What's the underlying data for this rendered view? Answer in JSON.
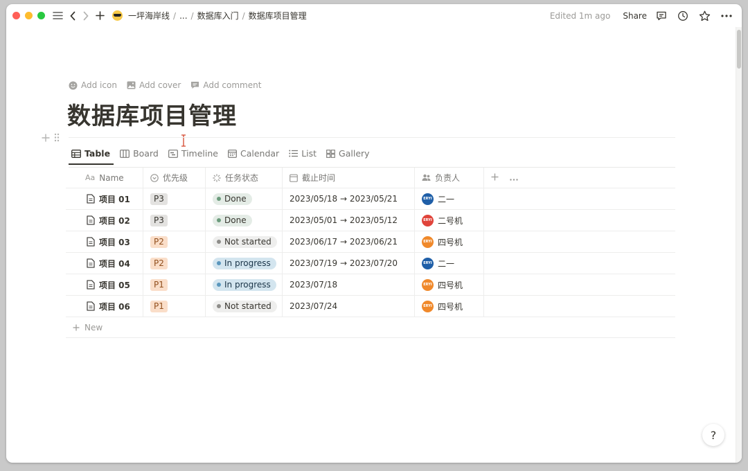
{
  "window": {
    "traffic_colors": [
      "#ff5f57",
      "#febc2e",
      "#28c840"
    ]
  },
  "breadcrumbs": {
    "workspace": "一坪海岸线",
    "ellipsis": "...",
    "parent": "数据库入门",
    "current": "数据库项目管理"
  },
  "topbar": {
    "edited": "Edited 1m ago",
    "share": "Share"
  },
  "page_actions": {
    "add_icon": "Add icon",
    "add_cover": "Add cover",
    "add_comment": "Add comment"
  },
  "page": {
    "title": "数据库项目管理"
  },
  "views": {
    "table": "Table",
    "board": "Board",
    "timeline": "Timeline",
    "calendar": "Calendar",
    "list": "List",
    "gallery": "Gallery"
  },
  "table": {
    "headers": {
      "name_prefix": "Aa",
      "name": "Name",
      "priority": "优先级",
      "status": "任务状态",
      "deadline": "截止时间",
      "owner": "负责人"
    },
    "rows": [
      {
        "name": "项目 01",
        "priority": "P3",
        "status": "Done",
        "deadline": "2023/05/18 → 2023/05/21",
        "owner": "二一",
        "avatar": "ERYI",
        "avatar_color": "#1f5fa8"
      },
      {
        "name": "项目 02",
        "priority": "P3",
        "status": "Done",
        "deadline": "2023/05/01 → 2023/05/12",
        "owner": "二号机",
        "avatar": "ERYI",
        "avatar_color": "#e0443b"
      },
      {
        "name": "项目 03",
        "priority": "P2",
        "status": "Not started",
        "deadline": "2023/06/17 → 2023/06/21",
        "owner": "四号机",
        "avatar": "ERYI",
        "avatar_color": "#f0892b"
      },
      {
        "name": "项目 04",
        "priority": "P2",
        "status": "In progress",
        "deadline": "2023/07/19 → 2023/07/20",
        "owner": "二一",
        "avatar": "ERYI",
        "avatar_color": "#1f5fa8"
      },
      {
        "name": "项目 05",
        "priority": "P1",
        "status": "In progress",
        "deadline": "2023/07/18",
        "owner": "四号机",
        "avatar": "ERYI",
        "avatar_color": "#f0892b"
      },
      {
        "name": "项目 06",
        "priority": "P1",
        "status": "Not started",
        "deadline": "2023/07/24",
        "owner": "四号机",
        "avatar": "ERYI",
        "avatar_color": "#f0892b"
      }
    ],
    "new_label": "New"
  },
  "help": "?",
  "colors": {
    "priority": {
      "P3": {
        "bg": "#e3e2e0",
        "fg": "#37352f"
      },
      "P2": {
        "bg": "#fadec9",
        "fg": "#914f1d"
      },
      "P1": {
        "bg": "#fadec9",
        "fg": "#914f1d"
      }
    },
    "status": {
      "Done": {
        "bg": "#e4ece6",
        "fg": "#37352f",
        "dot": "#6c9b7d"
      },
      "Not started": {
        "bg": "#eeeeed",
        "fg": "#37352f",
        "dot": "#8e8d8a"
      },
      "In progress": {
        "bg": "#d3e5ef",
        "fg": "#183347",
        "dot": "#5b97bd"
      }
    }
  }
}
